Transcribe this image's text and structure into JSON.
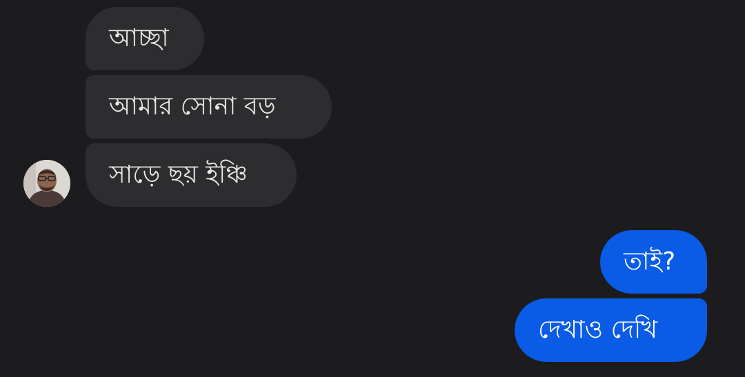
{
  "conversation": {
    "incoming": [
      {
        "text": "আচ্ছা"
      },
      {
        "text": "আমার সোনা বড়"
      },
      {
        "text": "সাড়ে ছয় ইঞ্চি"
      }
    ],
    "outgoing": [
      {
        "text": "তাই?"
      },
      {
        "text": "দেখাও দেখি"
      }
    ]
  },
  "colors": {
    "background": "#1c1c1e",
    "incoming_bubble": "#2d2d2f",
    "outgoing_bubble": "#0a5ce6",
    "incoming_text": "#e8e8e8",
    "outgoing_text": "#ffffff"
  },
  "avatar": {
    "icon": "contact-avatar"
  }
}
